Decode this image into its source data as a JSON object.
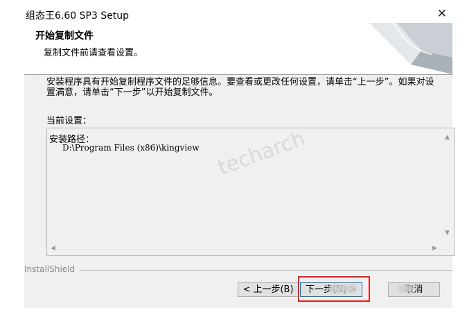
{
  "window": {
    "title": "组态王6.60 SP3 Setup",
    "close_glyph": "✕"
  },
  "header": {
    "title": "开始复制文件",
    "subtitle": "复制文件前请查看设置。"
  },
  "description": "安装程序具有开始复制程序文件的足够信息。要查看或更改任何设置，请单击“上一步”。如果对设置满意，请单击“下一步”以开始复制文件。",
  "current_settings": {
    "label": "当前设置：",
    "lines": [
      "安装路径：",
      "D:\\Program Files (x86)\\kingview"
    ]
  },
  "watermark": "techarch",
  "brand": "InstallShield",
  "buttons": {
    "back": "< 上一步(B)",
    "next": "下一步(N) >",
    "cancel": "取消"
  },
  "colors": {
    "highlight": "#e02020",
    "default_button_border": "#0078d7"
  }
}
